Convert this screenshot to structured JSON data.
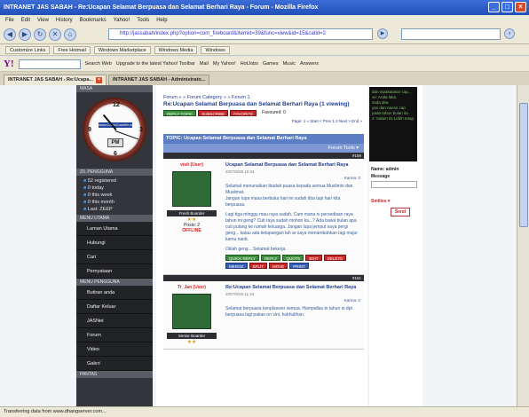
{
  "window": {
    "title": "INTRANET JAS SABAH - Re:Ucapan Selamat Berpuasa dan Selamat Berhari Raya - Forum - Mozilla Firefox",
    "minimize": "_",
    "maximize": "□",
    "close": "×"
  },
  "menu": [
    "File",
    "Edit",
    "View",
    "History",
    "Bookmarks",
    "Yahoo!",
    "Tools",
    "Help"
  ],
  "nav": {
    "back": "◀",
    "forward": "▶",
    "reload": "↻",
    "stop": "✕",
    "home": "⌂",
    "url": "http://jassabah/index.php?option=com_fireboard&Itemid=39&func=view&id=15&catid=2",
    "go": "▶"
  },
  "bookmarks": [
    "Customize Links",
    "Free Hotmail",
    "Windows Marketplace",
    "Windows Media",
    "Windows"
  ],
  "yahoo": {
    "logo": "Y!",
    "items": [
      "Search Web",
      "Upgrade to the latest Yahoo! Toolbar",
      "Mail",
      "My Yahoo!",
      "HotJobs",
      "Games",
      "Music",
      "Answers"
    ]
  },
  "tabs": [
    {
      "label": "INTRANET JAS SABAH - Re:Ucapa...",
      "active": true
    },
    {
      "label": "INTRANET JAS SABAH - Administrato...",
      "active": false
    }
  ],
  "sidebar": {
    "masa_heading": "MASA",
    "clock": {
      "n12": "12",
      "n3": "3",
      "n6": "6",
      "n9": "9",
      "logo": "www.CasioCounter.com",
      "ampm": "PM"
    },
    "pengguna_heading": "ZIL PENGGUNA",
    "stats": [
      "52 registered",
      "0 today",
      "0 this week",
      "0 this month",
      "Last: ZEEP"
    ],
    "menu_utama_heading": "MENU UTAMA",
    "menu_utama": [
      "Laman Utama",
      "Hubungi",
      "Cari",
      "Pernyataan"
    ],
    "menu_pengguna_heading": "MENU PENGGUNA",
    "menu_pengguna": [
      "Butiran anda",
      "Daftar Keluar",
      "JASNet",
      "Forum",
      "Video",
      "Galeri"
    ],
    "pantas_heading": "PANTAS"
  },
  "main": {
    "crumbs": "Forum » » Forum Category » » Forum 1",
    "topic_title": "Re:Ucapan Selamat Berpuasa dan Selamat Berhari Raya (1 viewing)",
    "buttons": [
      "REPLY TOPIC",
      "SUBSCRIBE",
      "FAVORITE"
    ],
    "favoured": "Favoured: 0",
    "pages": "Page: 1 « Start < Prev 1 2 Next > End »",
    "topic_bar": "TOPIC: Ucapan Selamat Berpuasa dan Selamat Berhari Raya",
    "tools": "Forum Tools ▾",
    "posts": [
      {
        "num": "#159",
        "author": "visit (User)",
        "rank": "Fresh Boarder",
        "posts": "Posts: 2",
        "online": "OFFLINE",
        "title": "Ucapan Selamat Berpuasa dan Selamat Berhari Raya",
        "date": "2007/9/28 10:34",
        "karma": "Karma: 0",
        "text1": "Selamat menunaikan ibadah puasa kepada semua Muslimin dan Muslimat.",
        "text2": "Jangan lupa masa berbuka hari ini sudah tiba tapi hari kita berpuasa.",
        "text3": "Lagi tiga minggu mau raya sudah. Cam mana ni persediaan raya tahun ini geng? Cuti raya sudah mohon ka...? Ada bawa bulan apa cuti pulang ke rumah keluarga. Jangan lupa jemput saya pergi geng... kalau ada kelapangan lah ar saya menambahkan lagi mujur kamu nanti.",
        "sig": "Oklah geng... Selamat bekerja.",
        "actions": [
          "QUICK REPLY",
          "REPLY",
          "QUOTE",
          "EDIT",
          "DELETE",
          "MERGE",
          "SPLIT",
          "MOVE",
          "PRINT"
        ]
      },
      {
        "num": "#161",
        "author": "Tr_Jan (User)",
        "rank": "Senior Boarder",
        "posts": "Posts: 2",
        "title": "Re:Ucapan Selamat Berpuasa dan Selamat Berhari Raya",
        "date": "2007/9/28 11:44",
        "karma": "Karma: 0",
        "text1": "Selamat berpuasa kenplaswer semua. Hampallas in tahun ni dpt berpuasa lagi pakan on sini, hukhulihan."
      }
    ]
  },
  "right": {
    "chat": [
      "dan mpakatasar cap...",
      "",
      "ve: Arala laka",
      "sada dea",
      "",
      "yas dan nacan cap",
      "pada tahun bulan ita",
      "2: Salam ini Lebih tetap"
    ],
    "name_label": "Name: admin",
    "message_label": "Message",
    "smilies": "Smilies ▾",
    "send": "Send"
  },
  "status": "Transferring data from www.dhangserver.com..."
}
